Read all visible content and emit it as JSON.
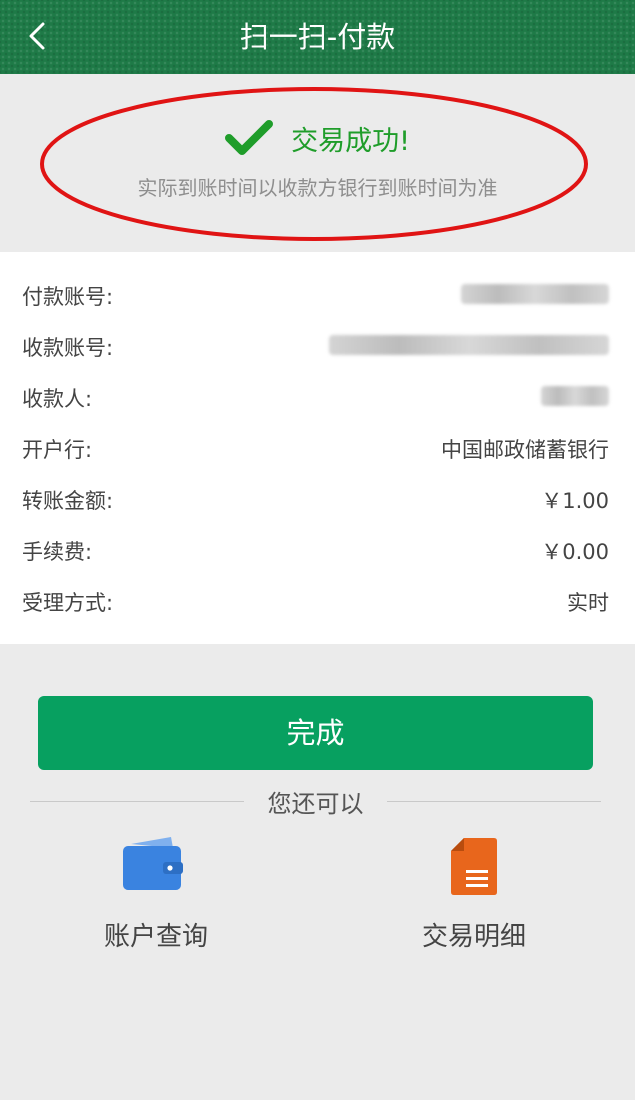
{
  "header": {
    "title": "扫一扫-付款"
  },
  "status": {
    "title": "交易成功!",
    "note": "实际到账时间以收款方银行到账时间为准",
    "color": "#1f9d2a",
    "annotation_color": "#e01414"
  },
  "details": [
    {
      "label": "付款账号:",
      "value": ""
    },
    {
      "label": "收款账号:",
      "value": ""
    },
    {
      "label": "收款人:",
      "value": ""
    },
    {
      "label": "开户行:",
      "value": "中国邮政储蓄银行"
    },
    {
      "label": "转账金额:",
      "value": "￥1.00"
    },
    {
      "label": "手续费:",
      "value": "￥0.00"
    },
    {
      "label": "受理方式:",
      "value": "实时"
    }
  ],
  "done_button": {
    "label": "完成",
    "color": "#07a060"
  },
  "more": {
    "label": "您还可以",
    "actions": [
      {
        "label": "账户查询",
        "icon": "wallet-icon",
        "color": "#3a83e0"
      },
      {
        "label": "交易明细",
        "icon": "document-icon",
        "color": "#e8661c"
      }
    ]
  },
  "theme": {
    "header_color": "#1e7a47",
    "background": "#ebebeb"
  }
}
